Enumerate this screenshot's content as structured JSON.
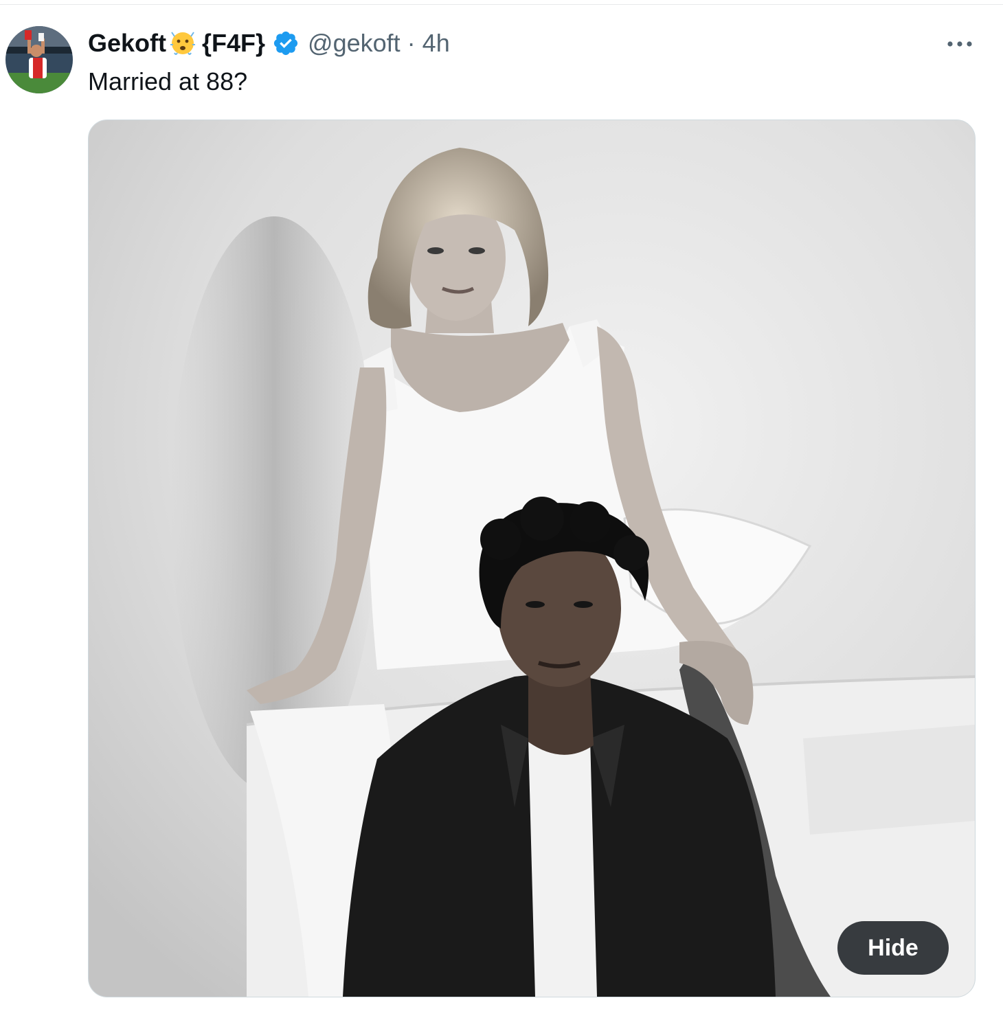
{
  "tweet": {
    "author": {
      "display_name": "Gekoft",
      "name_suffix": "{F4F}",
      "emoji": "face-holding-back-tears-emoji",
      "verified_badge": "verified-badge-icon",
      "handle": "@gekoft",
      "separator": "·",
      "time": "4h"
    },
    "more_icon": "more-horizontal-icon",
    "text": "Married at 88?",
    "media": {
      "alt": "Black and white photo of a woman in a white dress seated behind a young man in a dark suit jacket",
      "hide_label": "Hide"
    }
  },
  "colors": {
    "text_primary": "#0f1419",
    "text_secondary": "#536471",
    "verified_blue": "#1d9bf0",
    "media_border": "#cfd9de",
    "hide_button_bg": "#0f1419"
  }
}
